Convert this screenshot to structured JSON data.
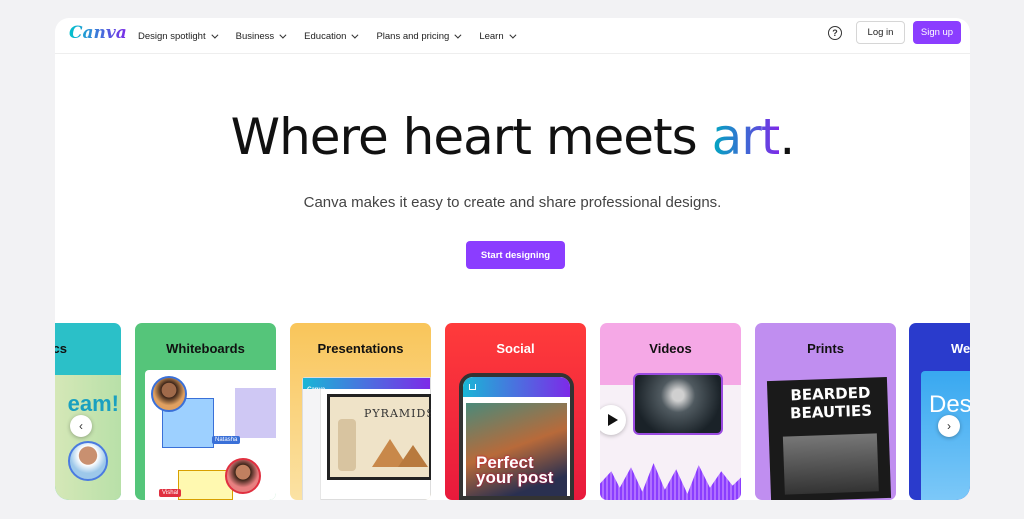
{
  "nav": {
    "logo": "Canva",
    "items": [
      {
        "label": "Design spotlight"
      },
      {
        "label": "Business"
      },
      {
        "label": "Education"
      },
      {
        "label": "Plans and pricing"
      },
      {
        "label": "Learn"
      }
    ],
    "help_glyph": "?",
    "login_label": "Log in",
    "signup_label": "Sign up"
  },
  "hero": {
    "title_main": "Where heart meets ",
    "title_accent": "art",
    "title_end": ".",
    "subtitle": "Canva makes it easy to create and share professional designs.",
    "cta_label": "Start designing"
  },
  "cards": [
    {
      "title": "cs",
      "partial": true,
      "snippet": "eam!",
      "bg": "#2bc0c8"
    },
    {
      "title": "Whiteboards",
      "bg": "#55c57a",
      "tags": [
        "Natasha",
        "Vishal"
      ]
    },
    {
      "title": "Presentations",
      "bg": "#f7b84a",
      "logo": "Canva",
      "doc_text": "PYRAMIDS"
    },
    {
      "title": "Social",
      "bg": "#f23b3b",
      "post_text": "Perfect your post"
    },
    {
      "title": "Videos",
      "bg": "#f09ad9"
    },
    {
      "title": "Prints",
      "bg": "#c08ef0",
      "poster_title": "BEARDED BEAUTIES"
    },
    {
      "title": "We",
      "partial": true,
      "snippet": "Des",
      "bg": "#2a3bcc"
    }
  ],
  "carousel": {
    "prev_glyph": "‹",
    "next_glyph": "›"
  },
  "colors": {
    "brand": "#8b3dff",
    "accent_start": "#00c4cc",
    "accent_end": "#7d2ae8"
  },
  "icons": [
    "help-icon",
    "chevron-down-icon",
    "play-icon",
    "home-icon"
  ]
}
